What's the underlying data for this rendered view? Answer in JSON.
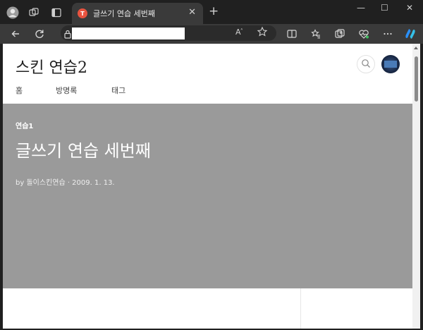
{
  "browser": {
    "tab": {
      "title": "글쓰기 연습 세번째",
      "favicon_letter": "T",
      "favicon_color": "#e8533f"
    },
    "window_controls": {
      "minimize": "—",
      "maximize": "☐",
      "close": "✕"
    }
  },
  "page": {
    "blog_title": "스킨 연습2",
    "nav": [
      "홈",
      "방명록",
      "태그"
    ],
    "hero": {
      "category": "연습1",
      "title": "글쓰기 연습 세번째",
      "meta": "by 돌이스킨연습 · 2009. 1. 13."
    },
    "hero_color": "#9a9a9a"
  },
  "icons": {
    "profile": "profile-icon",
    "workspaces": "workspaces-icon",
    "tab_actions": "tab-actions-icon",
    "back": "back-icon",
    "refresh": "refresh-icon",
    "lock": "lock-icon",
    "read_aloud": "read-aloud-icon",
    "favorite": "favorite-icon",
    "split_screen": "split-screen-icon",
    "favorites": "favorites-icon",
    "collections": "collections-icon",
    "health": "browser-essentials-icon",
    "more": "more-icon",
    "copilot": "copilot-icon",
    "search": "search-icon"
  }
}
